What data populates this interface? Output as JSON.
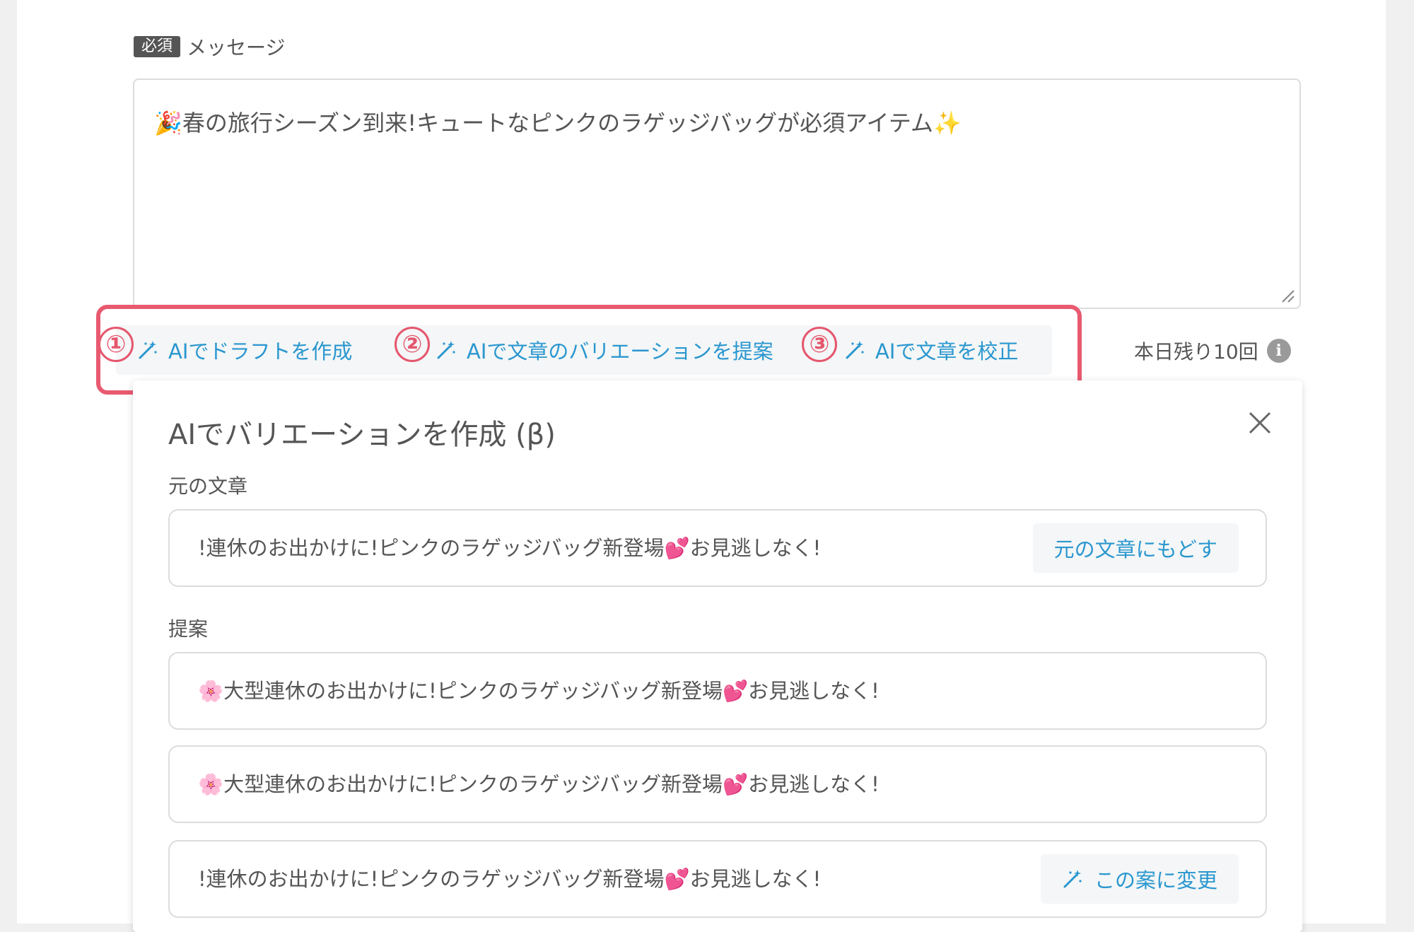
{
  "message": {
    "required_badge": "必須",
    "label": "メッセージ",
    "value": "🎉春の旅行シーズン到来!キュートなピンクのラゲッジバッグが必須アイテム✨"
  },
  "ai_actions": [
    {
      "step": "①",
      "label": "AIでドラフトを作成"
    },
    {
      "step": "②",
      "label": "AIで文章のバリエーションを提案"
    },
    {
      "step": "③",
      "label": "AIで文章を校正"
    }
  ],
  "remaining": "本日残り10回",
  "panel": {
    "title": "AIでバリエーションを作成 (β)",
    "original_label": "元の文章",
    "original_text": "!連休のお出かけに!ピンクのラゲッジバッグ新登場💕お見逃しなく!",
    "restore_button": "元の文章にもどす",
    "suggestions_label": "提案",
    "suggestions": [
      "🌸大型連休のお出かけに!ピンクのラゲッジバッグ新登場💕お見逃しなく!",
      "🌸大型連休のお出かけに!ピンクのラゲッジバッグ新登場💕お見逃しなく!",
      "!連休のお出かけに!ピンクのラゲッジバッグ新登場💕お見逃しなく!"
    ],
    "apply_button": "この案に変更"
  },
  "colors": {
    "accent": "#2a97cf",
    "highlight": "#e85a70",
    "text": "#555555"
  }
}
